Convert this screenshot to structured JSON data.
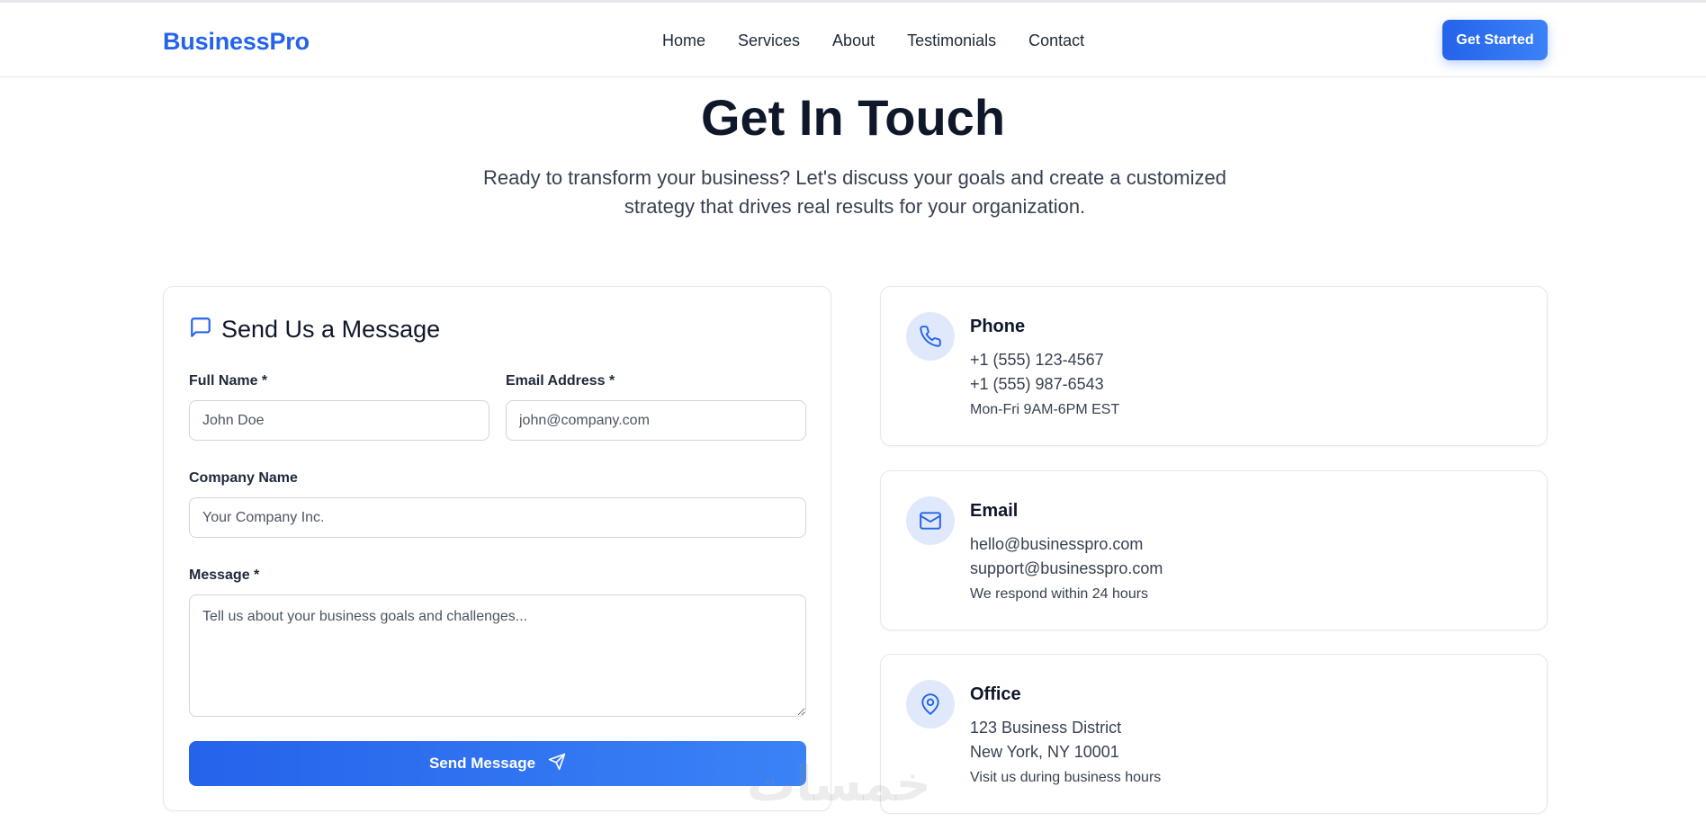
{
  "nav": {
    "brand": "BusinessPro",
    "links": [
      "Home",
      "Services",
      "About",
      "Testimonials",
      "Contact"
    ],
    "cta": "Get Started"
  },
  "hero": {
    "title": "Get In Touch",
    "subtitle_line1": "Ready to transform your business? Let's discuss your goals and create a customized",
    "subtitle_line2": "strategy that drives real results for your organization."
  },
  "form": {
    "title": "Send Us a Message",
    "full_name_label": "Full Name *",
    "full_name_placeholder": "John Doe",
    "email_label": "Email Address *",
    "email_placeholder": "john@company.com",
    "company_label": "Company Name",
    "company_placeholder": "Your Company Inc.",
    "message_label": "Message *",
    "message_placeholder": "Tell us about your business goals and challenges...",
    "submit_label": "Send Message"
  },
  "contact": {
    "phone": {
      "icon": "phone-icon",
      "title": "Phone",
      "line1": "+1 (555) 123-4567",
      "line2": "+1 (555) 987-6543",
      "note": "Mon-Fri 9AM-6PM EST"
    },
    "email": {
      "icon": "mail-icon",
      "title": "Email",
      "line1": "hello@businesspro.com",
      "line2": "support@businesspro.com",
      "note": "We respond within 24 hours"
    },
    "office": {
      "icon": "map-pin-icon",
      "title": "Office",
      "line1": "123 Business District",
      "line2": "New York, NY 10001",
      "note": "Visit us during business hours"
    }
  },
  "colors": {
    "brand": "#2563eb",
    "heading": "#0f172a",
    "body_text": "#374151",
    "icon_bg": "#e0e9fb",
    "border": "#e5e7eb"
  }
}
